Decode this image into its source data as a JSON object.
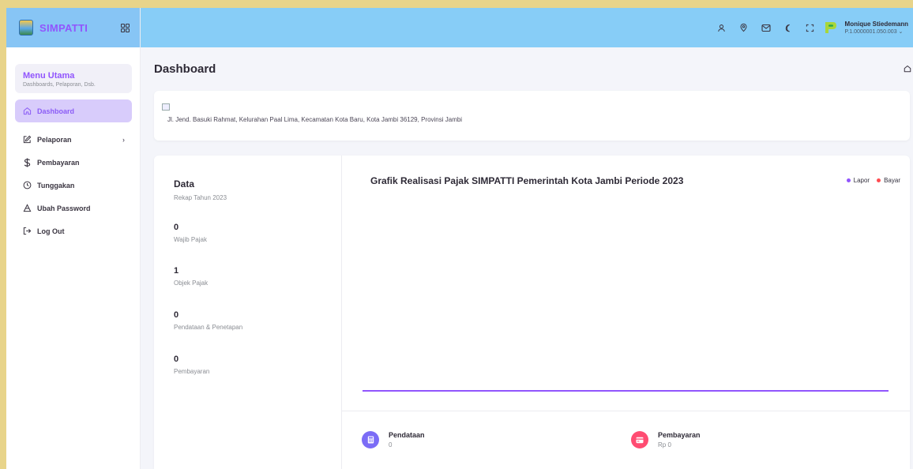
{
  "brand": {
    "name": "SIMPATTI"
  },
  "menu": {
    "title": "Menu Utama",
    "subtitle": "Dashboards, Pelaporan, Dsb."
  },
  "nav": [
    {
      "label": "Dashboard",
      "icon": "home-icon",
      "active": true
    },
    {
      "label": "Pelaporan",
      "icon": "edit-icon",
      "has_children": true
    },
    {
      "label": "Pembayaran",
      "icon": "dollar-icon"
    },
    {
      "label": "Tunggakan",
      "icon": "clock-icon"
    },
    {
      "label": "Ubah Password",
      "icon": "lock-icon"
    },
    {
      "label": "Log Out",
      "icon": "logout-icon"
    }
  ],
  "nav_arrow": "›",
  "user": {
    "name": "Monique Stiedemann",
    "id": "P.1.0000001.050.003 ⌄"
  },
  "page": {
    "title": "Dashboard"
  },
  "address": "Jl. Jend. Basuki Rahmat, Kelurahan Paal Lima, Kecamatan Kota Baru, Kota Jambi 36129, Provinsi Jambi",
  "summary": {
    "title": "Data",
    "subtitle": "Rekap Tahun 2023",
    "stats": [
      {
        "value": "0",
        "label": "Wajib Pajak"
      },
      {
        "value": "1",
        "label": "Objek Pajak"
      },
      {
        "value": "0",
        "label": "Pendataan & Penetapan"
      },
      {
        "value": "0",
        "label": "Pembayaran"
      }
    ]
  },
  "chart": {
    "title": "Grafik Realisasi Pajak SIMPATTI Pemerintah Kota Jambi Periode 2023",
    "legend": [
      {
        "name": "Lapor",
        "color": "#9155fd"
      },
      {
        "name": "Bayar",
        "color": "#ff4c51"
      }
    ]
  },
  "chart_data": {
    "type": "line",
    "title": "Grafik Realisasi Pajak SIMPATTI Pemerintah Kota Jambi Periode 2023",
    "series": [
      {
        "name": "Lapor",
        "color": "#9155fd",
        "values": [
          0,
          0,
          0,
          0,
          0,
          0,
          0,
          0,
          0,
          0,
          0,
          0
        ]
      },
      {
        "name": "Bayar",
        "color": "#ff4c51",
        "values": [
          0,
          0,
          0,
          0,
          0,
          0,
          0,
          0,
          0,
          0,
          0,
          0
        ]
      }
    ],
    "grid": false,
    "legend_position": "top-right"
  },
  "bottom": [
    {
      "label": "Pendataan",
      "value": "0",
      "color": "#7b6cf6",
      "icon": "calculator-icon"
    },
    {
      "label": "Pembayaran",
      "value": "Rp 0",
      "color": "#ff4c72",
      "icon": "receipt-icon"
    }
  ],
  "colors": {
    "accent": "#9155fd",
    "topbar": "#87cdf7",
    "page_bg": "#f4f5fa"
  }
}
